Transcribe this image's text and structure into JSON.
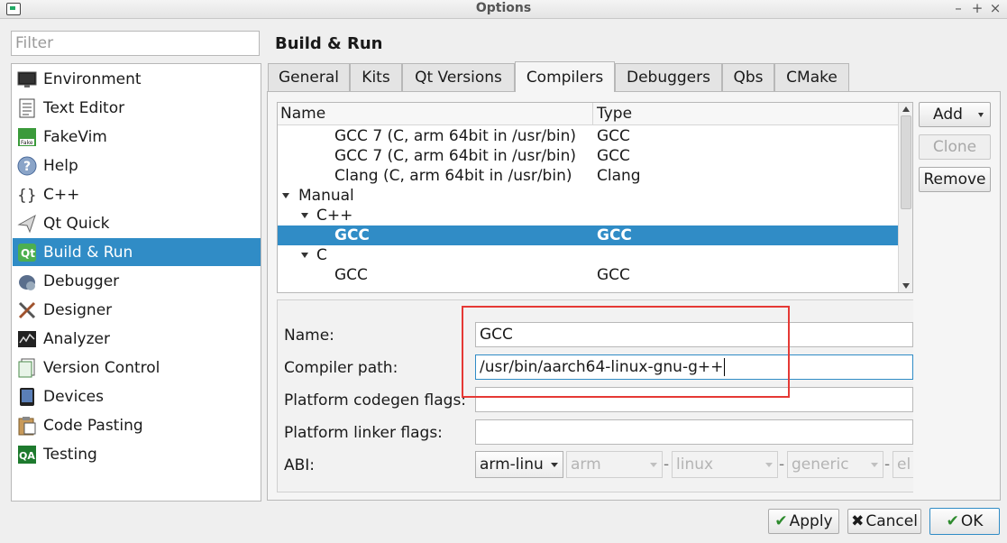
{
  "window": {
    "title": "Options"
  },
  "filter": {
    "placeholder": "Filter"
  },
  "sidebar": {
    "items": [
      {
        "label": "Environment",
        "icon": "monitor-icon"
      },
      {
        "label": "Text Editor",
        "icon": "text-document-icon"
      },
      {
        "label": "FakeVim",
        "icon": "fakevim-icon"
      },
      {
        "label": "Help",
        "icon": "help-icon"
      },
      {
        "label": "C++",
        "icon": "cpp-braces-icon"
      },
      {
        "label": "Qt Quick",
        "icon": "qt-quick-icon"
      },
      {
        "label": "Build & Run",
        "icon": "build-run-icon",
        "selected": true
      },
      {
        "label": "Debugger",
        "icon": "debugger-icon"
      },
      {
        "label": "Designer",
        "icon": "designer-icon"
      },
      {
        "label": "Analyzer",
        "icon": "analyzer-icon"
      },
      {
        "label": "Version Control",
        "icon": "version-control-icon"
      },
      {
        "label": "Devices",
        "icon": "devices-icon"
      },
      {
        "label": "Code Pasting",
        "icon": "code-pasting-icon"
      },
      {
        "label": "Testing",
        "icon": "testing-qa-icon"
      }
    ]
  },
  "main": {
    "title": "Build & Run",
    "tabs": [
      "General",
      "Kits",
      "Qt Versions",
      "Compilers",
      "Debuggers",
      "Qbs",
      "CMake"
    ],
    "active_tab": "Compilers",
    "tree": {
      "headers": {
        "name": "Name",
        "type": "Type"
      },
      "rows": [
        {
          "name": "GCC 7 (C, arm 64bit in /usr/bin)",
          "type": "GCC"
        },
        {
          "name": "GCC 7 (C, arm 64bit in /usr/bin)",
          "type": "GCC"
        },
        {
          "name": "Clang (C, arm 64bit in /usr/bin)",
          "type": "Clang"
        },
        {
          "name": "Manual",
          "type": ""
        },
        {
          "name": "C++",
          "type": ""
        },
        {
          "name": "GCC",
          "type": "GCC",
          "selected": true
        },
        {
          "name": "C",
          "type": ""
        },
        {
          "name": "GCC",
          "type": "GCC"
        }
      ]
    },
    "side_buttons": {
      "add": "Add",
      "clone": "Clone",
      "remove": "Remove"
    },
    "form": {
      "name_label": "Name:",
      "name_value": "GCC",
      "path_label": "Compiler path:",
      "path_value": "/usr/bin/aarch64-linux-gnu-g++",
      "codegen_label": "Platform codegen flags:",
      "codegen_value": "",
      "linker_label": "Platform linker flags:",
      "linker_value": "",
      "abi_label": "ABI:",
      "abi": [
        "arm-linu",
        "arm",
        "linux",
        "generic",
        "el"
      ],
      "abi_sep": "-"
    }
  },
  "footer": {
    "apply": "Apply",
    "cancel": "Cancel",
    "ok": "OK"
  },
  "colors": {
    "selection": "#308cc6",
    "highlight_box": "#e53935"
  }
}
